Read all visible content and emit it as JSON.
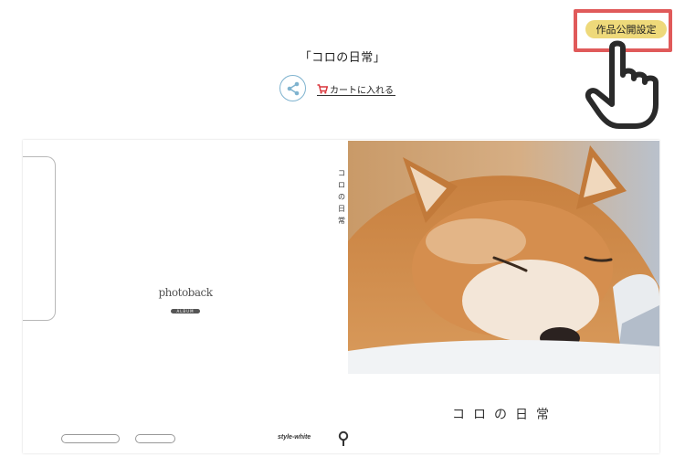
{
  "header": {
    "title": "「コロの日常」",
    "cart_label": "カートに入れる",
    "publish_label": "作品公開設定"
  },
  "icons": {
    "share": "share-icon",
    "cart": "cart-icon",
    "pointer": "pointing-hand-icon"
  },
  "book": {
    "spine_chars": [
      "コ",
      "ロ",
      "の",
      "日",
      "常"
    ],
    "cover_title": "コロの日常",
    "logo_text": "photoback",
    "logo_sub": "ALBUM",
    "style_label": "style-white"
  },
  "colors": {
    "highlight": "#e05a5a",
    "publish_button": "#eed97a",
    "share_ring": "#7fb3cf",
    "cart_icon": "#d9343a"
  }
}
